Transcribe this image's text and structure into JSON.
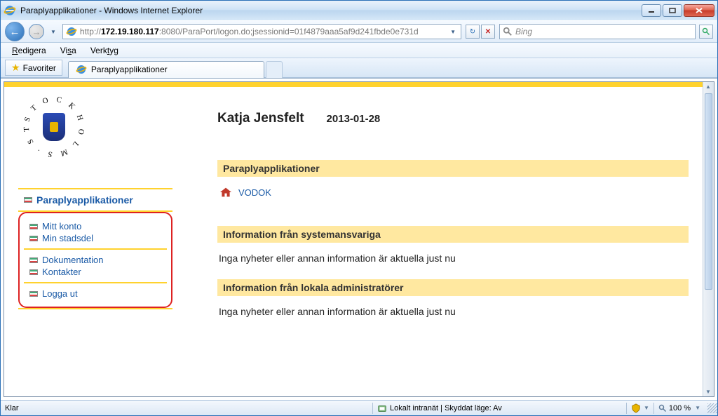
{
  "window": {
    "title": "Paraplyapplikationer - Windows Internet Explorer"
  },
  "nav": {
    "url_prefix": "http://",
    "url_host": "172.19.180.117",
    "url_suffix": ":8080/ParaPort/logon.do;jsessionid=01f4879aaa5af9d241fbde0e731d",
    "search_placeholder": "Bing"
  },
  "menu": {
    "edit": "Redigera",
    "view": "Visa",
    "tools": "Verktyg"
  },
  "favorites_label": "Favoriter",
  "tab": {
    "title": "Paraplyapplikationer"
  },
  "sidebar": {
    "root": "Paraplyapplikationer",
    "groups": [
      {
        "items": [
          "Mitt konto",
          "Min stadsdel"
        ]
      },
      {
        "items": [
          "Dokumentation",
          "Kontakter"
        ]
      },
      {
        "items": [
          "Logga ut"
        ]
      }
    ]
  },
  "main": {
    "user": "Katja Jensfelt",
    "date": "2013-01-28",
    "section1": "Paraplyapplikationer",
    "app_link": "VODOK",
    "section2": "Information från systemansvariga",
    "info2": "Inga nyheter eller annan information är aktuella just nu",
    "section3": "Information från lokala administratörer",
    "info3": "Inga nyheter eller annan information är aktuella just nu"
  },
  "status": {
    "ready": "Klar",
    "zone": "Lokalt intranät | Skyddat läge: Av",
    "zoom": "100 %"
  }
}
